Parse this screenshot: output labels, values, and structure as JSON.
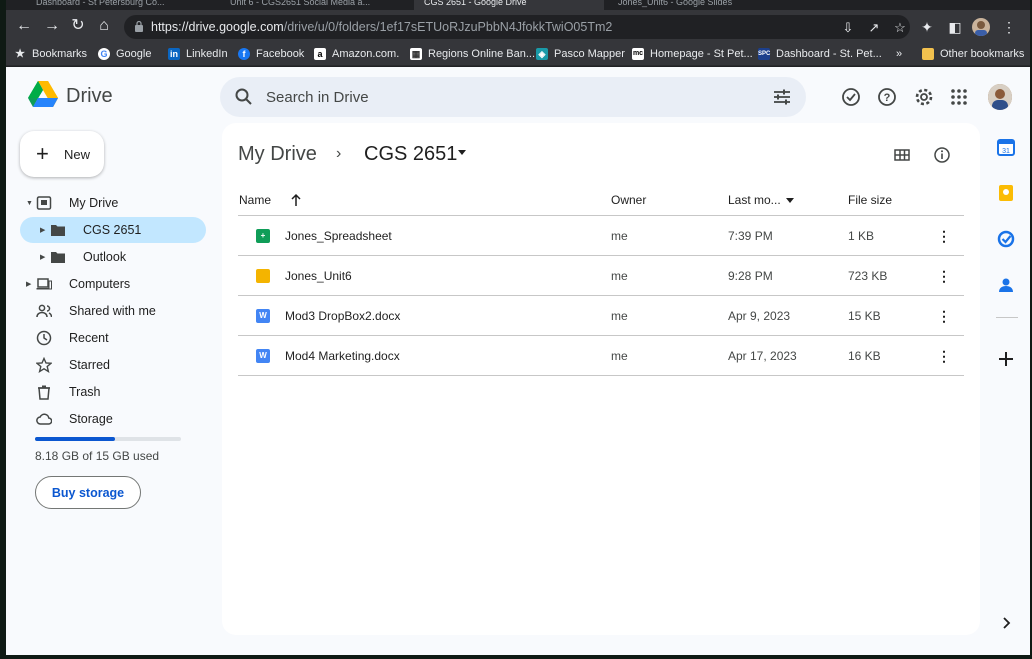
{
  "browser": {
    "tabs": [
      {
        "title": "Dashboard - St Petersburg Co..."
      },
      {
        "title": "Unit 6 - CGS2651 Social Media a..."
      },
      {
        "title": "CGS 2651 - Google Drive"
      },
      {
        "title": "Jones_Unit6 - Google Slides"
      }
    ],
    "url_host": "https://drive.google.com",
    "url_path": "/drive/u/0/folders/1ef17sETUoRJzuPbbN4JfokkTwiO05Tm2",
    "bookmarks": [
      {
        "label": "Bookmarks",
        "icon": "star-icon",
        "color": "#e8eaed"
      },
      {
        "label": "Google",
        "icon": "google-icon",
        "color": "#ffffff"
      },
      {
        "label": "LinkedIn",
        "icon": "linkedin-icon",
        "color": "#0a66c2"
      },
      {
        "label": "Facebook",
        "icon": "facebook-icon",
        "color": "#1877f2"
      },
      {
        "label": "Amazon.com.",
        "icon": "amazon-icon",
        "color": "#ffffff"
      },
      {
        "label": "Regions Online Ban...",
        "icon": "regions-icon",
        "color": "#ffffff"
      },
      {
        "label": "Pasco Mapper",
        "icon": "pasco-icon",
        "color": "#1a73e8"
      },
      {
        "label": "Homepage - St Pet...",
        "icon": "mc-icon",
        "color": "#ffffff"
      },
      {
        "label": "Dashboard - St. Pet...",
        "icon": "spc-icon",
        "color": "#1c3f8c"
      }
    ],
    "other_bookmarks": "Other bookmarks",
    "overflow": "»"
  },
  "header": {
    "brand": "Drive",
    "search_placeholder": "Search in Drive"
  },
  "sidebar": {
    "new_label": "New",
    "items": [
      {
        "label": "My Drive",
        "icon": "my-drive-icon"
      },
      {
        "label": "CGS 2651",
        "icon": "folder-icon"
      },
      {
        "label": "Outlook",
        "icon": "folder-icon"
      },
      {
        "label": "Computers",
        "icon": "computers-icon"
      },
      {
        "label": "Shared with me",
        "icon": "shared-icon"
      },
      {
        "label": "Recent",
        "icon": "clock-icon"
      },
      {
        "label": "Starred",
        "icon": "star-icon"
      },
      {
        "label": "Trash",
        "icon": "trash-icon"
      },
      {
        "label": "Storage",
        "icon": "cloud-icon"
      }
    ],
    "storage_used_fraction": 0.545,
    "storage_text": "8.18 GB of 15 GB used",
    "buy_storage": "Buy storage"
  },
  "main": {
    "breadcrumb_root": "My Drive",
    "breadcrumb_sep": "›",
    "breadcrumb_current": "CGS 2651",
    "columns": {
      "name": "Name",
      "owner": "Owner",
      "modified": "Last mo...",
      "size": "File size"
    },
    "files": [
      {
        "name": "Jones_Spreadsheet",
        "owner": "me",
        "modified": "7:39 PM",
        "size": "1 KB",
        "type": "sheets",
        "type_color": "#0f9d58",
        "glyph": "+"
      },
      {
        "name": "Jones_Unit6",
        "owner": "me",
        "modified": "9:28 PM",
        "size": "723 KB",
        "type": "slides",
        "type_color": "#f4b400",
        "glyph": ""
      },
      {
        "name": "Mod3 DropBox2.docx",
        "owner": "me",
        "modified": "Apr 9, 2023",
        "size": "15 KB",
        "type": "word",
        "type_color": "#4285f4",
        "glyph": "W"
      },
      {
        "name": "Mod4 Marketing.docx",
        "owner": "me",
        "modified": "Apr 17, 2023",
        "size": "16 KB",
        "type": "word",
        "type_color": "#4285f4",
        "glyph": "W"
      }
    ]
  },
  "colors": {
    "selected_nav": "#c2e7ff",
    "accent": "#0b57d0"
  }
}
